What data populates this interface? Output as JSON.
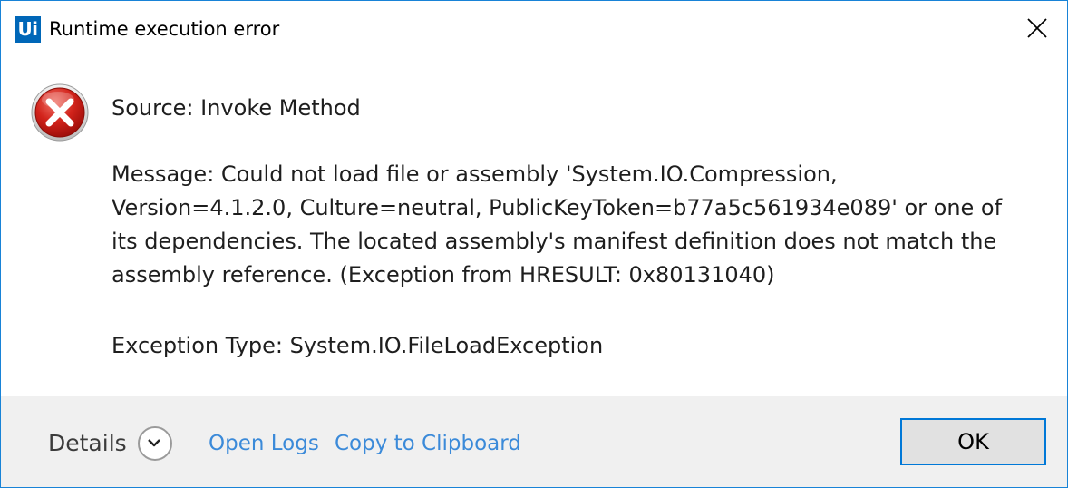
{
  "window": {
    "title": "Runtime execution error",
    "logo_text": "Ui",
    "close_icon": "close-icon",
    "accent_color": "#1883d7"
  },
  "content": {
    "icon": "error-icon",
    "source": "Source: Invoke Method",
    "message_lines": [
      "Message: Could not load file or assembly 'System.IO.Compression,",
      "Version=4.1.2.0, Culture=neutral, PublicKeyToken=b77a5c561934e089' or one of",
      "its dependencies. The located assembly's manifest definition does not match the",
      "assembly reference. (Exception from HRESULT: 0x80131040)"
    ],
    "exception_type": "Exception Type: System.IO.FileLoadException"
  },
  "footer": {
    "details_label": "Details",
    "details_icon": "chevron-down-icon",
    "open_logs": "Open Logs",
    "copy_to_clipboard": "Copy to Clipboard",
    "ok_label": "OK",
    "link_color": "#3b8ad9"
  }
}
